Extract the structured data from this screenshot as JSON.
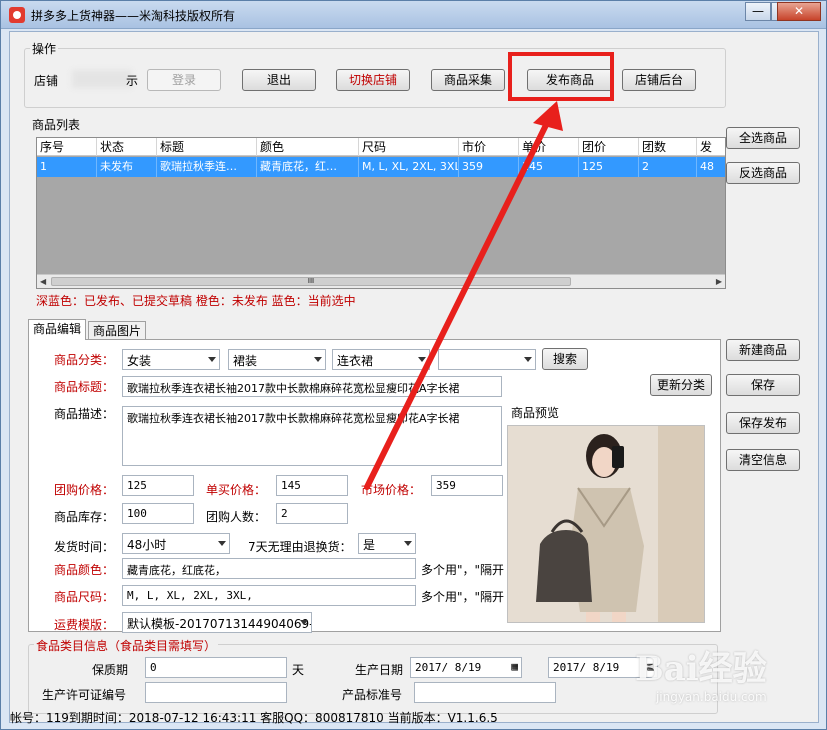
{
  "window": {
    "title": "拼多多上货神器——米淘科技版权所有",
    "controls": {
      "minimize": "—",
      "maximize": "□",
      "close": "✕"
    }
  },
  "ops": {
    "group_label": "操作",
    "shop_prefix": "店铺",
    "shop_suffix": "示",
    "login": "登录",
    "logout": "退出",
    "switch_shop": "切换店铺",
    "collect": "商品采集",
    "publish": "发布商品",
    "backend": "店铺后台"
  },
  "product_list": {
    "group_label": "商品列表",
    "columns": [
      "序号",
      "状态",
      "标题",
      "颜色",
      "尺码",
      "市价",
      "单价",
      "团价",
      "团数",
      "发"
    ],
    "rows": [
      [
        "1",
        "未发布",
        "歌瑞拉秋季连…",
        "藏青底花，红…",
        "M, L, XL, 2XL, 3XL,",
        "359",
        "145",
        "125",
        "2",
        "48"
      ]
    ],
    "scroll_thumb": "III",
    "legend": "深蓝色：已发布、已提交草稿  橙色：未发布  蓝色：当前选中"
  },
  "side_buttons": {
    "select_all": "全选商品",
    "invert": "反选商品",
    "new_product": "新建商品",
    "save": "保存",
    "save_publish": "保存发布",
    "clear": "清空信息"
  },
  "tabs": [
    {
      "label": "商品编辑",
      "active": true
    },
    {
      "label": "商品图片",
      "active": false
    }
  ],
  "editor": {
    "category_label": "商品分类：",
    "category1": "女装",
    "category2": "裙装",
    "category3": "连衣裙",
    "category4": "",
    "search": "搜索",
    "title_label": "商品标题：",
    "title_value": "歌瑞拉秋季连衣裙长袖2017款中长款棉麻碎花宽松显瘦印花A字长裙",
    "update_category": "更新分类",
    "desc_label": "商品描述：",
    "desc_value": "歌瑞拉秋季连衣裙长袖2017款中长款棉麻碎花宽松显瘦印花A字长裙",
    "preview_label": "商品预览",
    "group_price_label": "团购价格：",
    "group_price": "125",
    "single_price_label": "单买价格：",
    "single_price": "145",
    "market_price_label": "市场价格：",
    "market_price": "359",
    "stock_label": "商品库存：",
    "stock": "100",
    "group_size_label": "团购人数：",
    "group_size": "2",
    "ship_label": "发货时间：",
    "ship_value": "48小时",
    "return_label": "7天无理由退换货：",
    "return_value": "是",
    "color_label": "商品颜色：",
    "color_value": "藏青底花，红底花，",
    "color_hint": "多个用\"，\"隔开",
    "size_label": "商品尺码：",
    "size_value": "M, L, XL, 2XL, 3XL,",
    "size_hint": "多个用\"，\"隔开",
    "freight_label": "运费模版：",
    "freight_value": "默认模板-20170713144904069-"
  },
  "food": {
    "group_label": "食品类目信息（食品类目需填写）",
    "shelf_label": "保质期",
    "shelf_value": "0",
    "shelf_unit": "天",
    "prod_date_label": "生产日期",
    "prod_date_from": "2017/ 8/19",
    "prod_date_to": "2017/ 8/19",
    "license_label": "生产许可证编号",
    "license_value": "",
    "standard_label": "产品标准号",
    "standard_value": ""
  },
  "status": {
    "text": "帐号：119到期时间：2018-07-12 16:43:11  客服QQ：800817810  当前版本：V1.1.6.5"
  },
  "watermark": {
    "main": "Bai经验",
    "sub": "jingyan.baidu.com"
  },
  "colors": {
    "selection": "#3399ff",
    "annotation_red": "#e8201c",
    "label_red": "#c00000"
  }
}
